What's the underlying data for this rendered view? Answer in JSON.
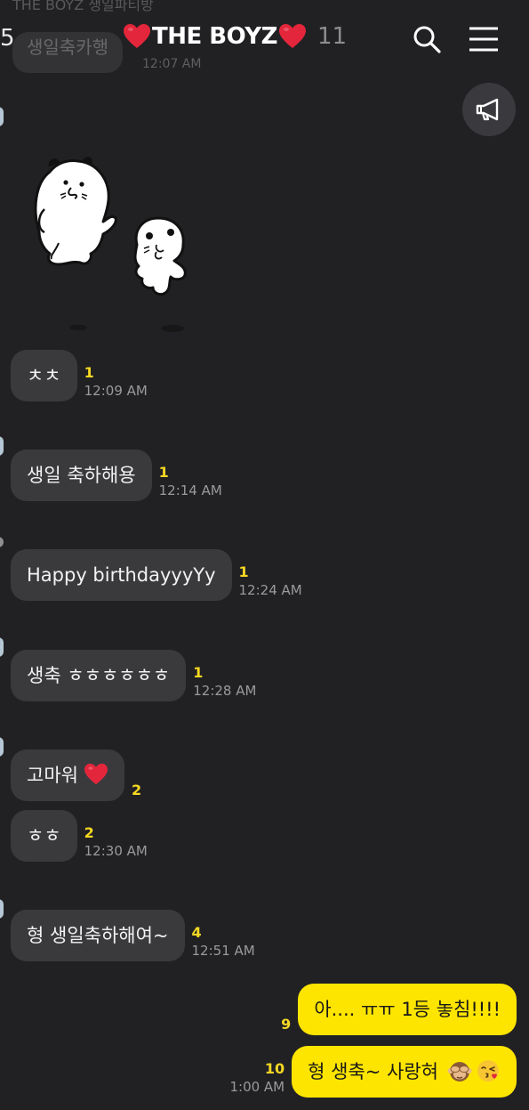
{
  "header": {
    "back_count": "5",
    "title": "THE BOYZ",
    "member_count": "11",
    "faded_previous_title": "THE BOYZ 생일파티방",
    "faded_previous_message": "생일축카행",
    "faded_previous_time": "12:07 AM"
  },
  "icons": {
    "title_heart": "red-heart-icon",
    "search": "search-icon",
    "menu": "hamburger-menu-icon",
    "notice": "megaphone-icon",
    "sticker": "sticker-characters"
  },
  "colors": {
    "background": "#212124",
    "incoming_bubble": "#3a3a3d",
    "outgoing_bubble": "#fee500",
    "unread_count": "#f6d823",
    "heart": "#e3263b"
  },
  "messages": [
    {
      "id": "m1",
      "text": "ㅊㅊ",
      "unread": "1",
      "time": "12:09 AM"
    },
    {
      "id": "m2",
      "text": "생일 축하해용",
      "unread": "1",
      "time": "12:14 AM"
    },
    {
      "id": "m3",
      "text": "Happy birthdayyyYy",
      "unread": "1",
      "time": "12:24 AM"
    },
    {
      "id": "m4",
      "text": "생축 ㅎㅎㅎㅎㅎㅎ",
      "unread": "1",
      "time": "12:28 AM"
    },
    {
      "id": "m5",
      "text": "고마워",
      "emoji": "red-heart",
      "unread": "2",
      "time": ""
    },
    {
      "id": "m6",
      "text": "ㅎㅎ",
      "unread": "2",
      "time": "12:30 AM"
    },
    {
      "id": "m7",
      "text": "형 생일축하해여~",
      "unread": "4",
      "time": "12:51 AM"
    }
  ],
  "my_messages": [
    {
      "id": "o1",
      "text": "아.... ㅠㅠ 1등 놓침!!!!",
      "unread": "9",
      "time": ""
    },
    {
      "id": "o2",
      "text": "형 생축~ 사랑혀",
      "emoji": [
        "see-no-evil-monkey",
        "kissing-face"
      ],
      "unread": "10",
      "time": "1:00 AM"
    }
  ]
}
